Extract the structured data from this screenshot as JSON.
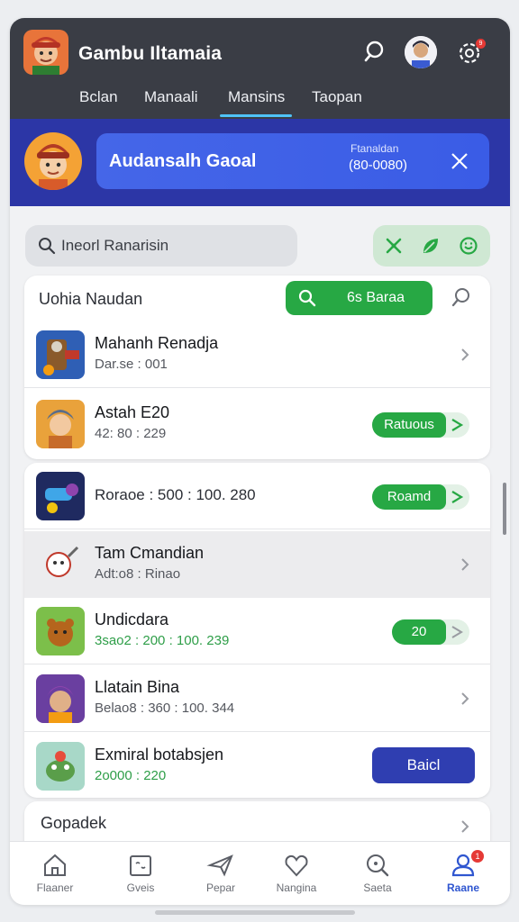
{
  "header": {
    "app_title": "Gambu Iltamaia",
    "tabs": [
      "Bclan",
      "Manaali",
      "Mansins",
      "Taopan"
    ],
    "active_tab": 2,
    "notification_count": "9"
  },
  "banner": {
    "title": "Audansalh Gaoal",
    "meta_top": "Ftanaldan",
    "meta_bottom": "(80-0080)"
  },
  "search": {
    "placeholder": "Ineorl Ranarisin"
  },
  "list_card": {
    "title": "Uohia Naudan",
    "search_button_label": "6s Baraa"
  },
  "items": [
    {
      "title": "Mahanh Renadja",
      "subtitle": "Dar.se : 001"
    },
    {
      "title": "Astah E20",
      "subtitle": "42: 80 : 229",
      "action": "Ratuous"
    },
    {
      "title": "",
      "subtitle": "Roraoe : 500 : 100. 280",
      "action": "Roamd"
    },
    {
      "title": "Tam Cmandian",
      "subtitle": "Adt:o8 : Rinao"
    },
    {
      "title": "Undicdara",
      "subtitle": "3sao2 : 200 : 100. 239",
      "action": "20"
    },
    {
      "title": "Llatain Bina",
      "subtitle": "Belao8 : 360 : 100. 344"
    },
    {
      "title": "Exmiral botabsjen",
      "subtitle": "2o000 : 220",
      "action": "Baicl"
    }
  ],
  "footer_card": {
    "title": "Gopadek"
  },
  "bottom_nav": [
    {
      "label": "Flaaner",
      "icon": "home-icon"
    },
    {
      "label": "Gveis",
      "icon": "calendar-icon"
    },
    {
      "label": "Pepar",
      "icon": "send-icon"
    },
    {
      "label": "Nangina",
      "icon": "heart-icon"
    },
    {
      "label": "Saeta",
      "icon": "search-icon"
    },
    {
      "label": "Raane",
      "icon": "profile-icon",
      "badge": "1"
    }
  ],
  "colors": {
    "header_bg": "#3a3d45",
    "banner_bg": "#2c36a6",
    "accent_green": "#27a844",
    "accent_blue": "#2f3eb1",
    "active_nav": "#2f56d0"
  }
}
